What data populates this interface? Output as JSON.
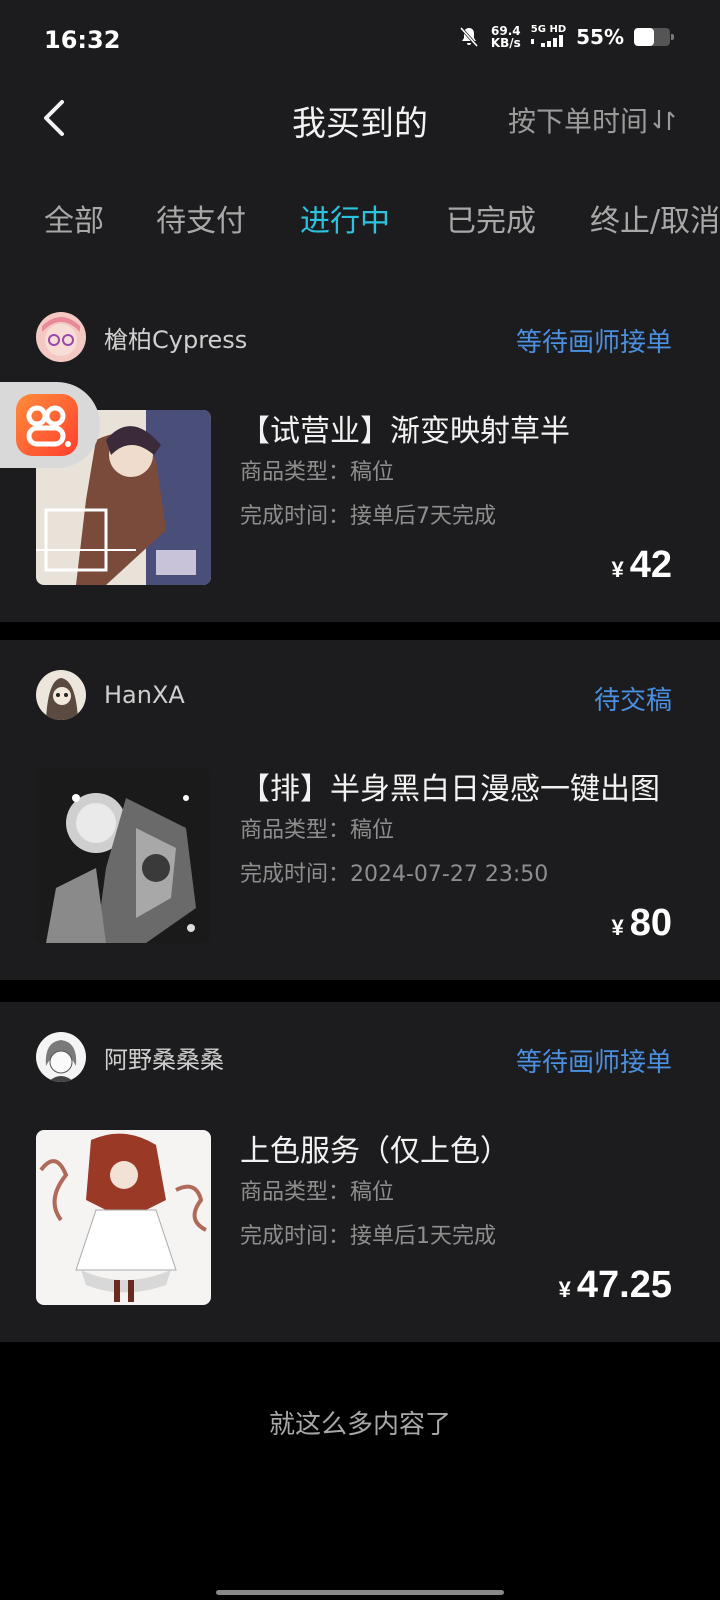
{
  "status_bar": {
    "time": "16:32",
    "net_speed_value": "69.4",
    "net_speed_unit": "KB/s",
    "signal_top": "5G HD",
    "battery": "55%",
    "battery_level": 0.55
  },
  "header": {
    "title": "我买到的",
    "sort_label": "按下单时间"
  },
  "tabs": [
    "全部",
    "待支付",
    "进行中",
    "已完成",
    "终止/取消"
  ],
  "active_tab": "进行中",
  "orders": [
    {
      "seller": "槍柏Cypress",
      "status": "等待画师接单",
      "title": "【试营业】渐变映射草半",
      "type_label": "商品类型：稿位",
      "time_label": "完成时间：接单后7天完成",
      "currency": "¥",
      "price": "42"
    },
    {
      "seller": "HanXA",
      "status": "待交稿",
      "title": "【排】半身黑白日漫感一键出图",
      "type_label": "商品类型：稿位",
      "time_label": "完成时间：2024-07-27 23:50",
      "currency": "¥",
      "price": "80"
    },
    {
      "seller": "阿野桑桑桑",
      "status": "等待画师接单",
      "title": "上色服务（仅上色）",
      "type_label": "商品类型：稿位",
      "time_label": "完成时间：接单后1天完成",
      "currency": "¥",
      "price": "47.25"
    }
  ],
  "footer": "就这么多内容了",
  "colors": {
    "accent_tab": "#2bc3e0",
    "status_blue": "#4a8fe0",
    "card_bg": "#1c1c1e"
  }
}
